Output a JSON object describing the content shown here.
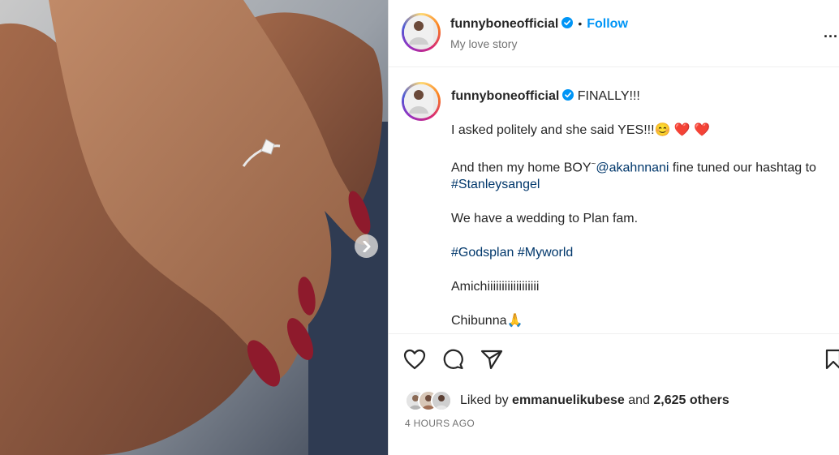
{
  "post": {
    "username": "funnyboneofficial",
    "follow_label": "Follow",
    "header_subtitle": "My love story",
    "more_label": "...",
    "dot_separator": "•"
  },
  "caption": {
    "username": "funnyboneofficial",
    "first_line": "FINALLY!!!",
    "line2": "I asked politely and she said YES!!!",
    "line2_emoji": "😊 ❤️ ❤️",
    "line3_prefix": "And then my home BOY",
    "line3_sup": "~",
    "line3_mention": "@akahnnani",
    "line3_suffix": " fine tuned our hashtag to",
    "line3_hashtag": "#Stanleysangel",
    "line4": "We have a wedding to Plan fam.",
    "hashtag_1": "#Godsplan",
    "hashtag_2": "#Myworld",
    "line6": "Amichiiiiiiiiiiiiiiiiii",
    "line7": "Chibunna",
    "line7_emoji": "🙏"
  },
  "likes": {
    "prefix": "Liked by",
    "user": "emmanuelikubese",
    "middle": "and",
    "count": "2,625 others"
  },
  "timestamp": "4 HOURS AGO",
  "icons": {
    "like": "heart-icon",
    "comment": "comment-icon",
    "share": "send-icon",
    "save": "bookmark-icon",
    "next": "chevron-right-icon",
    "verified": "verified-badge-icon"
  },
  "colors": {
    "accent": "#0095f6",
    "link": "#00376b",
    "verified": "#0095f6",
    "secondary_text": "#737373"
  }
}
